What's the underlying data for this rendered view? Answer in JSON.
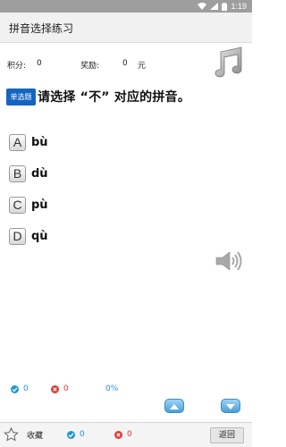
{
  "status_bar": {
    "time": "1:19"
  },
  "header": {
    "title": "拼音选择练习"
  },
  "score": {
    "points_label": "积分:",
    "points_value": "0",
    "reward_label": "奖励:",
    "reward_value": "0",
    "reward_unit": "元"
  },
  "question": {
    "type_badge": "单选题",
    "text": "请选择 “不” 对应的拼音。"
  },
  "options": [
    {
      "key": "A",
      "text": "bù"
    },
    {
      "key": "B",
      "text": "dù"
    },
    {
      "key": "C",
      "text": "pù"
    },
    {
      "key": "D",
      "text": "qù"
    }
  ],
  "stats": {
    "correct": "0",
    "wrong": "0",
    "rate": "0%"
  },
  "bottom": {
    "favorite_label": "收藏",
    "correct": "0",
    "wrong": "0",
    "back_label": "返回"
  },
  "colors": {
    "accent": "#1565c0",
    "correct": "#2196d6",
    "wrong": "#e53935"
  },
  "icons": {
    "music": "music-note-icon",
    "speaker": "speaker-icon",
    "favorite": "star-outline-icon"
  }
}
